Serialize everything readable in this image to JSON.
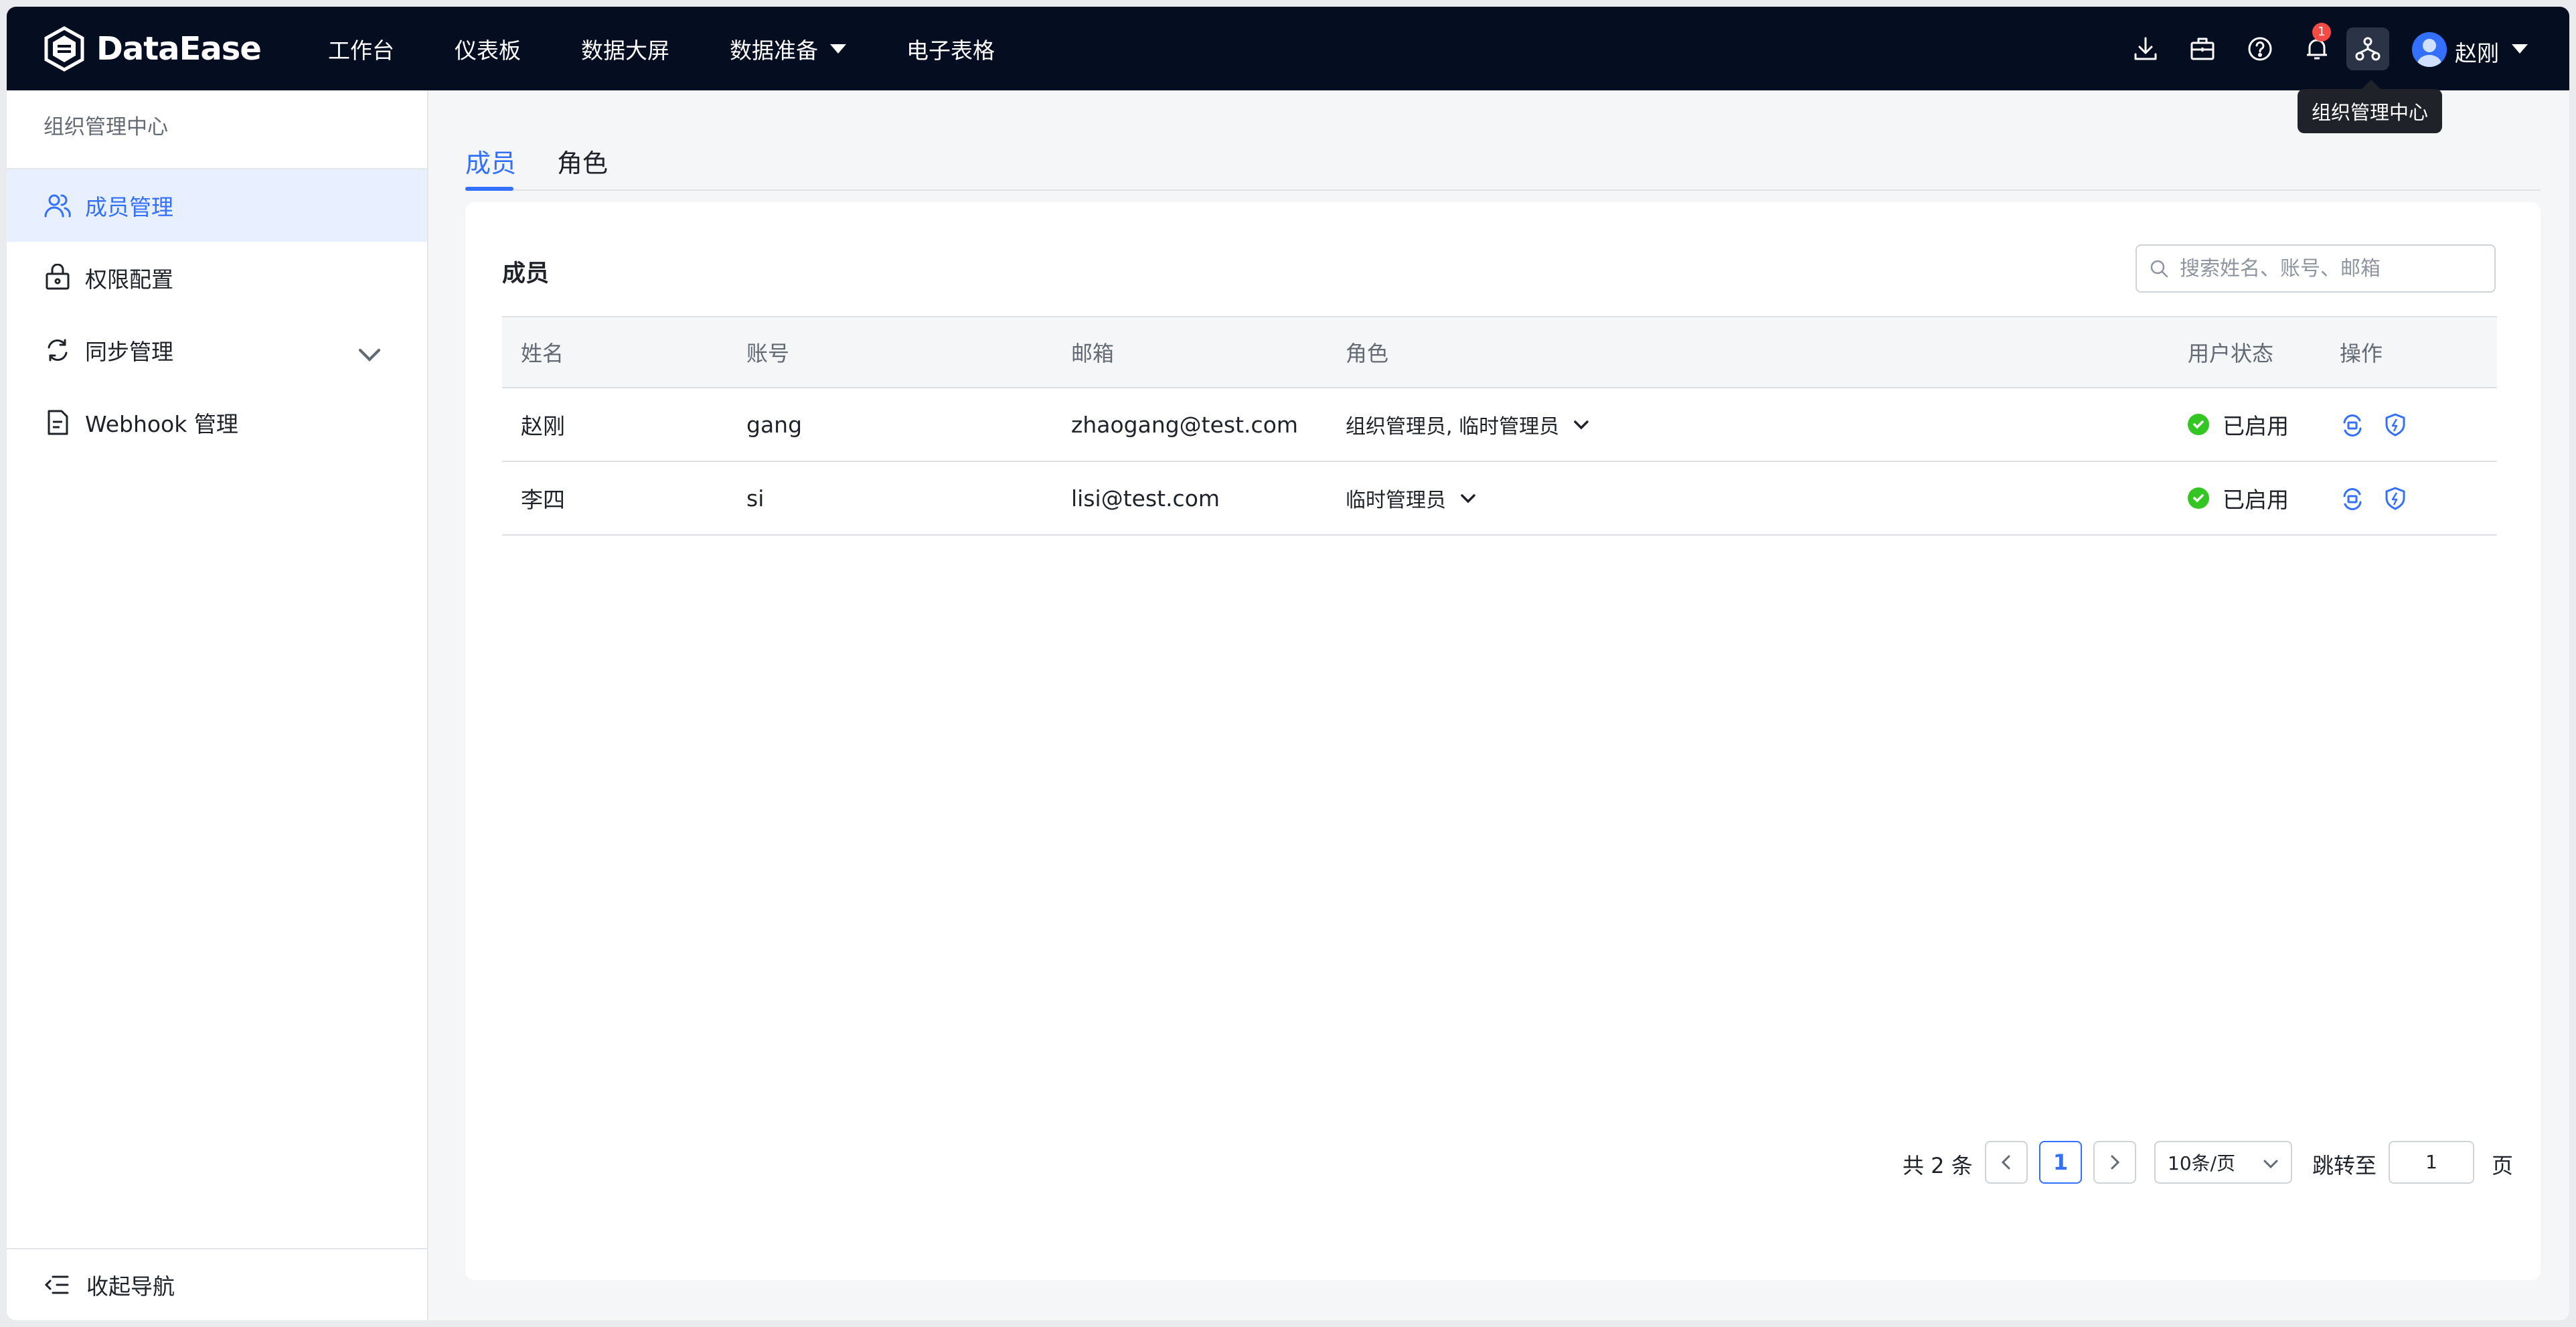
{
  "app": {
    "logo_text": "DataEase"
  },
  "nav": {
    "items": [
      "工作台",
      "仪表板",
      "数据大屏",
      "数据准备",
      "电子表格"
    ]
  },
  "header": {
    "notification_count": "1",
    "tooltip": "组织管理中心",
    "user_name": "赵刚",
    "icons": [
      "download-icon",
      "briefcase-icon",
      "help-icon",
      "bell-icon",
      "org-tree-icon"
    ]
  },
  "sidebar": {
    "title": "组织管理中心",
    "items": [
      {
        "label": "成员管理",
        "icon": "users-icon",
        "active": true
      },
      {
        "label": "权限配置",
        "icon": "lock-icon"
      },
      {
        "label": "同步管理",
        "icon": "sync-icon"
      },
      {
        "label": "Webhook 管理",
        "icon": "document-icon"
      }
    ],
    "collapse_label": "收起导航"
  },
  "tabs": [
    "成员",
    "角色"
  ],
  "card": {
    "title": "成员",
    "search_placeholder": "搜索姓名、账号、邮箱"
  },
  "table": {
    "headers": [
      "姓名",
      "账号",
      "邮箱",
      "角色",
      "用户状态",
      "操作"
    ],
    "rows": [
      {
        "name": "赵刚",
        "account": "gang",
        "email": "zhaogang@test.com",
        "role": "组织管理员, 临时管理员",
        "status": "已启用"
      },
      {
        "name": "李四",
        "account": "si",
        "email": "lisi@test.com",
        "role": "临时管理员",
        "status": "已启用"
      }
    ]
  },
  "pagination": {
    "total": "共 2 条",
    "current_page": "1",
    "page_size": "10条/页",
    "jump_label": "跳转至",
    "jump_value": "1",
    "page_suffix": "页"
  },
  "colors": {
    "accent": "#3370ff",
    "topbar": "#050e21",
    "success": "#34c724",
    "badge": "#f54a45"
  }
}
